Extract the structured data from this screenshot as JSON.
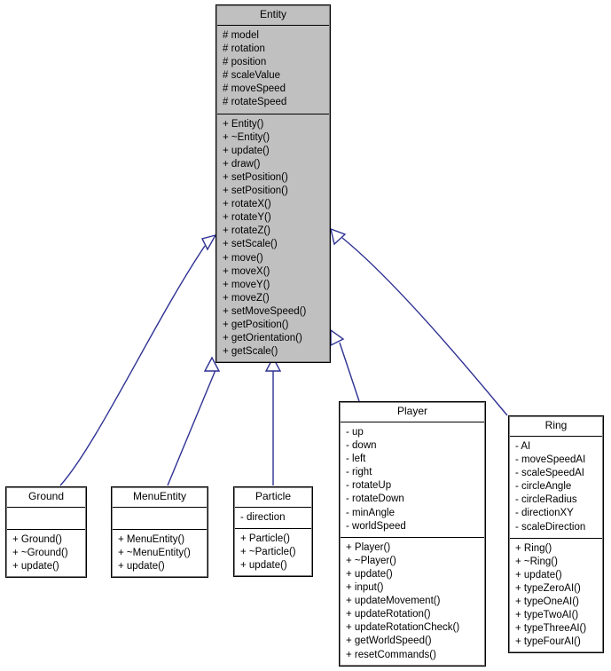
{
  "diagram": {
    "title": "Entity class inheritance diagram",
    "type": "uml-class-diagram",
    "relationship": "generalization",
    "edge_color": "#2e3192",
    "base_class_fill": "#c0c0c0",
    "derived_class_fill": "#ffffff",
    "border_color": "#000000"
  },
  "classes": [
    {
      "id": "entity",
      "name": "Entity",
      "shaded": true,
      "attributes": [
        "# model",
        "# rotation",
        "# position",
        "# scaleValue",
        "# moveSpeed",
        "# rotateSpeed"
      ],
      "methods": [
        "+ Entity()",
        "+ ~Entity()",
        "+ update()",
        "+ draw()",
        "+ setPosition()",
        "+ setPosition()",
        "+ rotateX()",
        "+ rotateY()",
        "+ rotateZ()",
        "+ setScale()",
        "+ move()",
        "+ moveX()",
        "+ moveY()",
        "+ moveZ()",
        "+ setMoveSpeed()",
        "+ getPosition()",
        "+ getOrientation()",
        "+ getScale()"
      ]
    },
    {
      "id": "ground",
      "name": "Ground",
      "shaded": false,
      "attributes": [],
      "methods": [
        "+ Ground()",
        "+ ~Ground()",
        "+ update()"
      ]
    },
    {
      "id": "menuentity",
      "name": "MenuEntity",
      "shaded": false,
      "attributes": [],
      "methods": [
        "+ MenuEntity()",
        "+ ~MenuEntity()",
        "+ update()"
      ]
    },
    {
      "id": "particle",
      "name": "Particle",
      "shaded": false,
      "attributes": [
        "- direction"
      ],
      "methods": [
        "+ Particle()",
        "+ ~Particle()",
        "+ update()"
      ]
    },
    {
      "id": "player",
      "name": "Player",
      "shaded": false,
      "attributes": [
        "- up",
        "- down",
        "- left",
        "- right",
        "- rotateUp",
        "- rotateDown",
        "- minAngle",
        "- worldSpeed"
      ],
      "methods": [
        "+ Player()",
        "+ ~Player()",
        "+ update()",
        "+ input()",
        "+ updateMovement()",
        "+ updateRotation()",
        "+ updateRotationCheck()",
        "+ getWorldSpeed()",
        "+ resetCommands()"
      ]
    },
    {
      "id": "ring",
      "name": "Ring",
      "shaded": false,
      "attributes": [
        "- AI",
        "- moveSpeedAI",
        "- scaleSpeedAI",
        "- circleAngle",
        "- circleRadius",
        "- directionXY",
        "- scaleDirection"
      ],
      "methods": [
        "+ Ring()",
        "+ ~Ring()",
        "+ update()",
        "+ typeZeroAI()",
        "+ typeOneAI()",
        "+ typeTwoAI()",
        "+ typeThreeAI()",
        "+ typeFourAI()"
      ]
    }
  ],
  "inheritance_edges": [
    {
      "from": "ground",
      "to": "entity"
    },
    {
      "from": "menuentity",
      "to": "entity"
    },
    {
      "from": "particle",
      "to": "entity"
    },
    {
      "from": "player",
      "to": "entity"
    },
    {
      "from": "ring",
      "to": "entity"
    }
  ]
}
